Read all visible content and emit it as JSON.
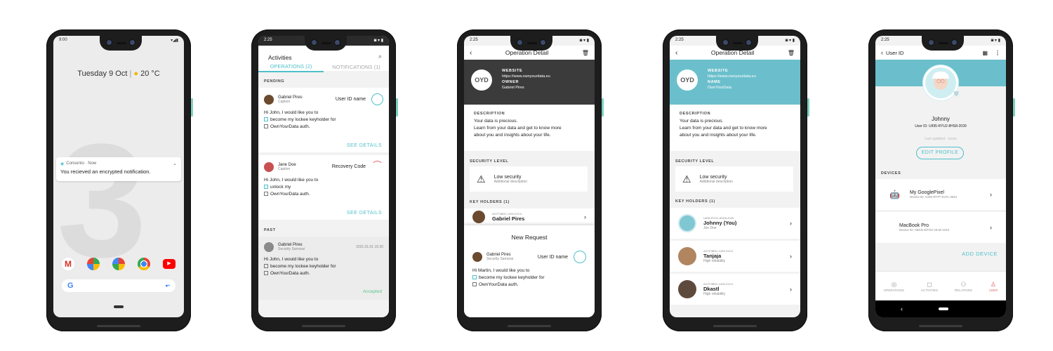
{
  "phone1": {
    "time": "9:00",
    "date": "Tuesday 9 Oct",
    "weather": "20 °C",
    "notif_header": "Consento · Now",
    "notif_text": "You recieved an encrypted notification.",
    "apps": [
      "gmail-icon",
      "maps-icon",
      "photos-icon",
      "chrome-icon",
      "youtube-icon"
    ],
    "google_letter": "G"
  },
  "phone2": {
    "time": "2:25",
    "title": "Activities",
    "tab_operations": "OPERATIONS (2)",
    "tab_notifications": "NOTIFICATIONS (1)",
    "section_pending": "PENDING",
    "section_past": "PAST",
    "cards": [
      {
        "name": "Gabriel Pires",
        "sub": "Caption",
        "right": "User ID name",
        "l1": "Hi John, I would like you to",
        "l2": "become my lockee keyholder for",
        "l3": "OwnYourData auth.",
        "cta": "SEE DETAILS"
      },
      {
        "name": "Jane Doe",
        "sub": "Caption",
        "right": "Recovery Code",
        "l1": "Hi John, I would like you to",
        "l2": "unlock my",
        "l3": "OwnYourData auth.",
        "cta": "SEE DETAILS"
      },
      {
        "name": "Gabriel Pires",
        "sub": "Security Samurai",
        "date": "2021.01.01 15:30",
        "l1": "Hi John, I would like you to",
        "l2": "become my lockee keyholder for",
        "l3": "OwnYourData auth.",
        "status": "Accepted"
      }
    ]
  },
  "phone3": {
    "time": "2:25",
    "title": "Operation Detail",
    "logo": "OYD",
    "website_label": "WEBSITE",
    "website": "https://www.ownyourdata.eu",
    "owner_label": "OWNER",
    "owner": "Gabriel Pires",
    "desc_label": "DESCRIPTION",
    "desc1": "Your data is precious.",
    "desc2": "Learn from your data and get to know more",
    "desc3": "about you and insights about your life.",
    "sec_label": "SECURITY LEVEL",
    "sec_title": "Low security",
    "sec_sub": "Additional description",
    "kh_label": "KEY HOLDERS (1)",
    "kh_id": "AG7F3B5C-1499-2XC4",
    "kh_name": "Gabriel Pires",
    "req_title": "New Request",
    "req_name": "Gabriel Pires",
    "req_sub": "Security Samurai",
    "req_right": "User ID name",
    "req_l1": "Hi Martin, I would like you to",
    "req_l2": "become my lockee keyholder for",
    "req_l3": "OwnYourData auth."
  },
  "phone4": {
    "time": "2:25",
    "title": "Operation Detail",
    "logo": "OYD",
    "website_label": "WEBSITE",
    "website": "https://www.ownyourdata.eu",
    "name_label": "NAME",
    "name": "OwnYourData",
    "desc_label": "DESCRIPTION",
    "desc1": "Your data is precious.",
    "desc2": "Learn from your data and get to know more",
    "desc3": "about you and insights about your life.",
    "sec_label": "SECURITY LEVEL",
    "sec_title": "Low security",
    "sec_sub": "Additional description",
    "kh_label": "KEY HOLDERS (1)",
    "holders": [
      {
        "id": "UII95-RYU2-8HS8-2039",
        "name": "Johnny (You)",
        "sub": "Jon Doe"
      },
      {
        "id": "AG7F3B5C-1499-2XC4",
        "name": "Tanjaja",
        "sub": "High reliability"
      },
      {
        "id": "AG7F3B5C-1499-2XC4",
        "name": "Dkastl",
        "sub": "High reliability"
      }
    ]
  },
  "phone5": {
    "time": "2:25",
    "back_label": "User ID",
    "name": "Johnny",
    "user_id": "User ID: UII95-RYU2-8HS8-2039",
    "last_updated": "Last updated : xxxxx",
    "edit_profile": "EDIT PROFILE",
    "devices_label": "DEVICES",
    "devices": [
      {
        "name": "My GooglePixel",
        "sub": "Device ID: HJDI-8T7F-DJ7L-2821"
      },
      {
        "name": "MacBook Pro",
        "sub": "Device ID: ABCD-EFGH-IJLM-1234"
      }
    ],
    "add_device": "ADD DEVICE",
    "nav": [
      "OPERATIONS",
      "ACTIVITIES",
      "RELATIONS",
      "USER"
    ]
  },
  "colors": {
    "accent": "#4fc0c9",
    "dark_header": "#3b3b3b",
    "teal_header": "#6bbfcc"
  }
}
